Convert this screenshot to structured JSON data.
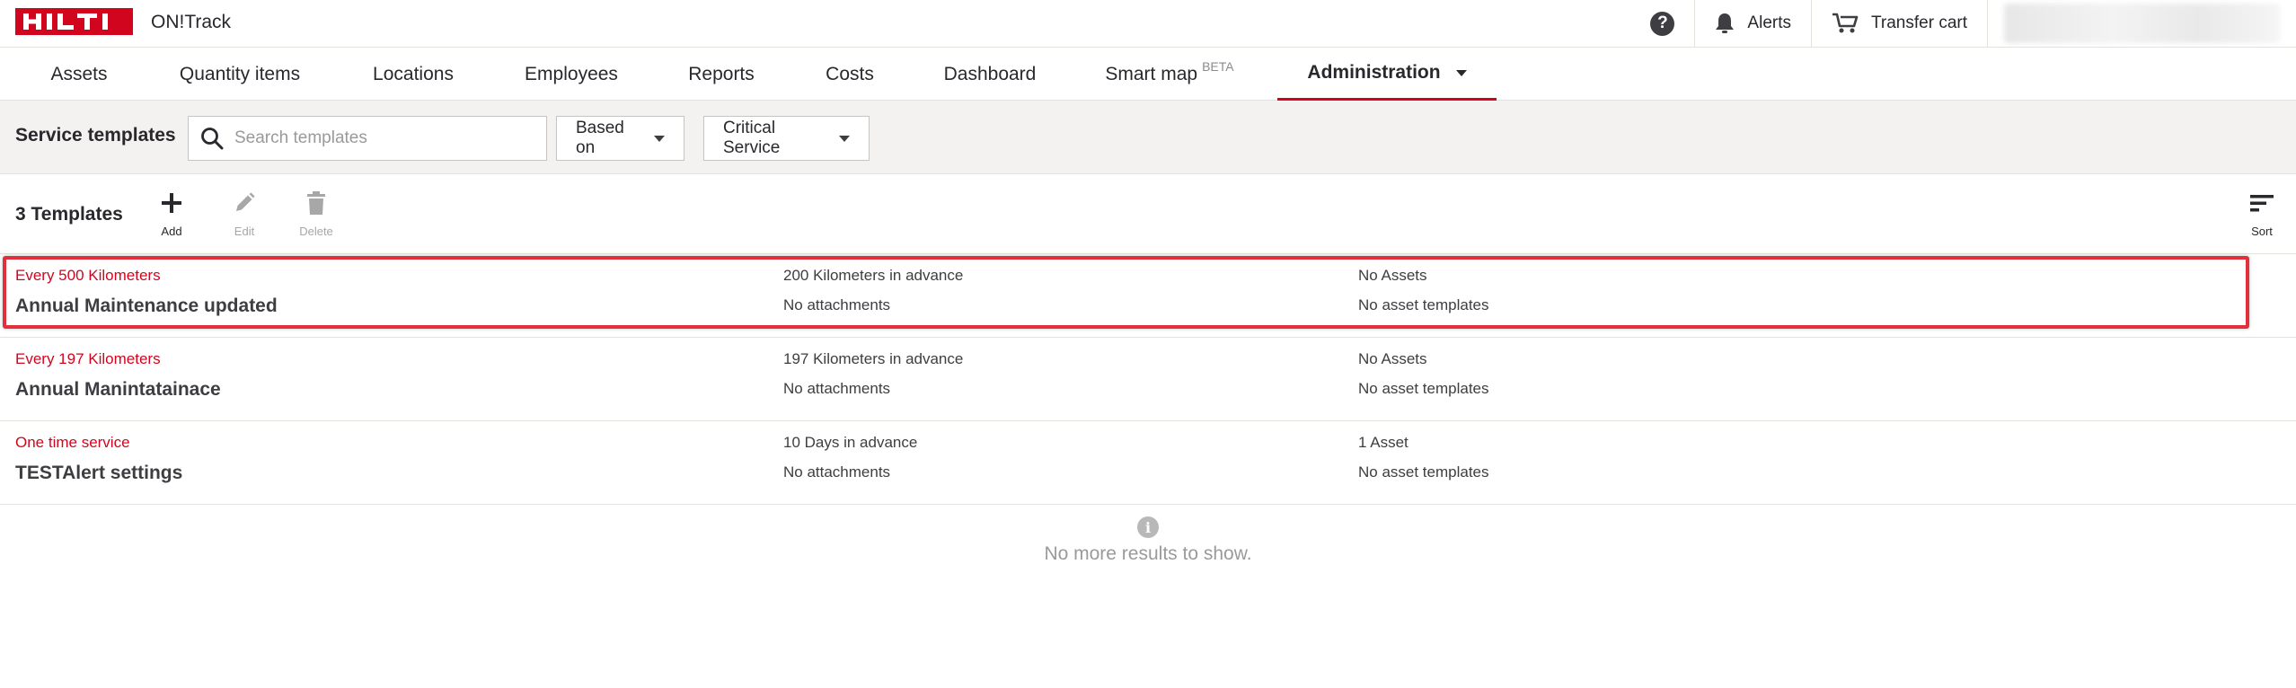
{
  "header": {
    "logo_text": "HILTI",
    "app_name": "ON!Track",
    "help_label": "?",
    "alerts_label": "Alerts",
    "transfer_cart_label": "Transfer cart",
    "brand_color": "#d2051e"
  },
  "nav": {
    "items": [
      {
        "label": "Assets"
      },
      {
        "label": "Quantity items"
      },
      {
        "label": "Locations"
      },
      {
        "label": "Employees"
      },
      {
        "label": "Reports"
      },
      {
        "label": "Costs"
      },
      {
        "label": "Dashboard"
      },
      {
        "label": "Smart map",
        "badge": "BETA"
      },
      {
        "label": "Administration",
        "active": true
      }
    ]
  },
  "filters": {
    "title": "Service templates",
    "search_placeholder": "Search templates",
    "based_on_label": "Based on",
    "critical_service_label": "Critical Service"
  },
  "toolbar": {
    "count_label": "3 Templates",
    "add_label": "Add",
    "edit_label": "Edit",
    "delete_label": "Delete",
    "sort_label": "Sort"
  },
  "templates": [
    {
      "frequency": "Every 500 Kilometers",
      "name": "Annual Maintenance updated",
      "advance": "200 Kilometers in advance",
      "attachments": "No attachments",
      "assets": "No Assets",
      "asset_templates": "No asset templates",
      "highlighted": true
    },
    {
      "frequency": "Every 197 Kilometers",
      "name": "Annual Manintatainace",
      "advance": "197 Kilometers in advance",
      "attachments": "No attachments",
      "assets": "No Assets",
      "asset_templates": "No asset templates"
    },
    {
      "frequency": "One time service",
      "name": "TESTAlert settings",
      "advance": "10 Days in advance",
      "attachments": "No attachments",
      "assets": "1 Asset",
      "asset_templates": "No asset templates"
    }
  ],
  "footer": {
    "info_icon_label": "i",
    "no_more_text": "No more results to show."
  }
}
